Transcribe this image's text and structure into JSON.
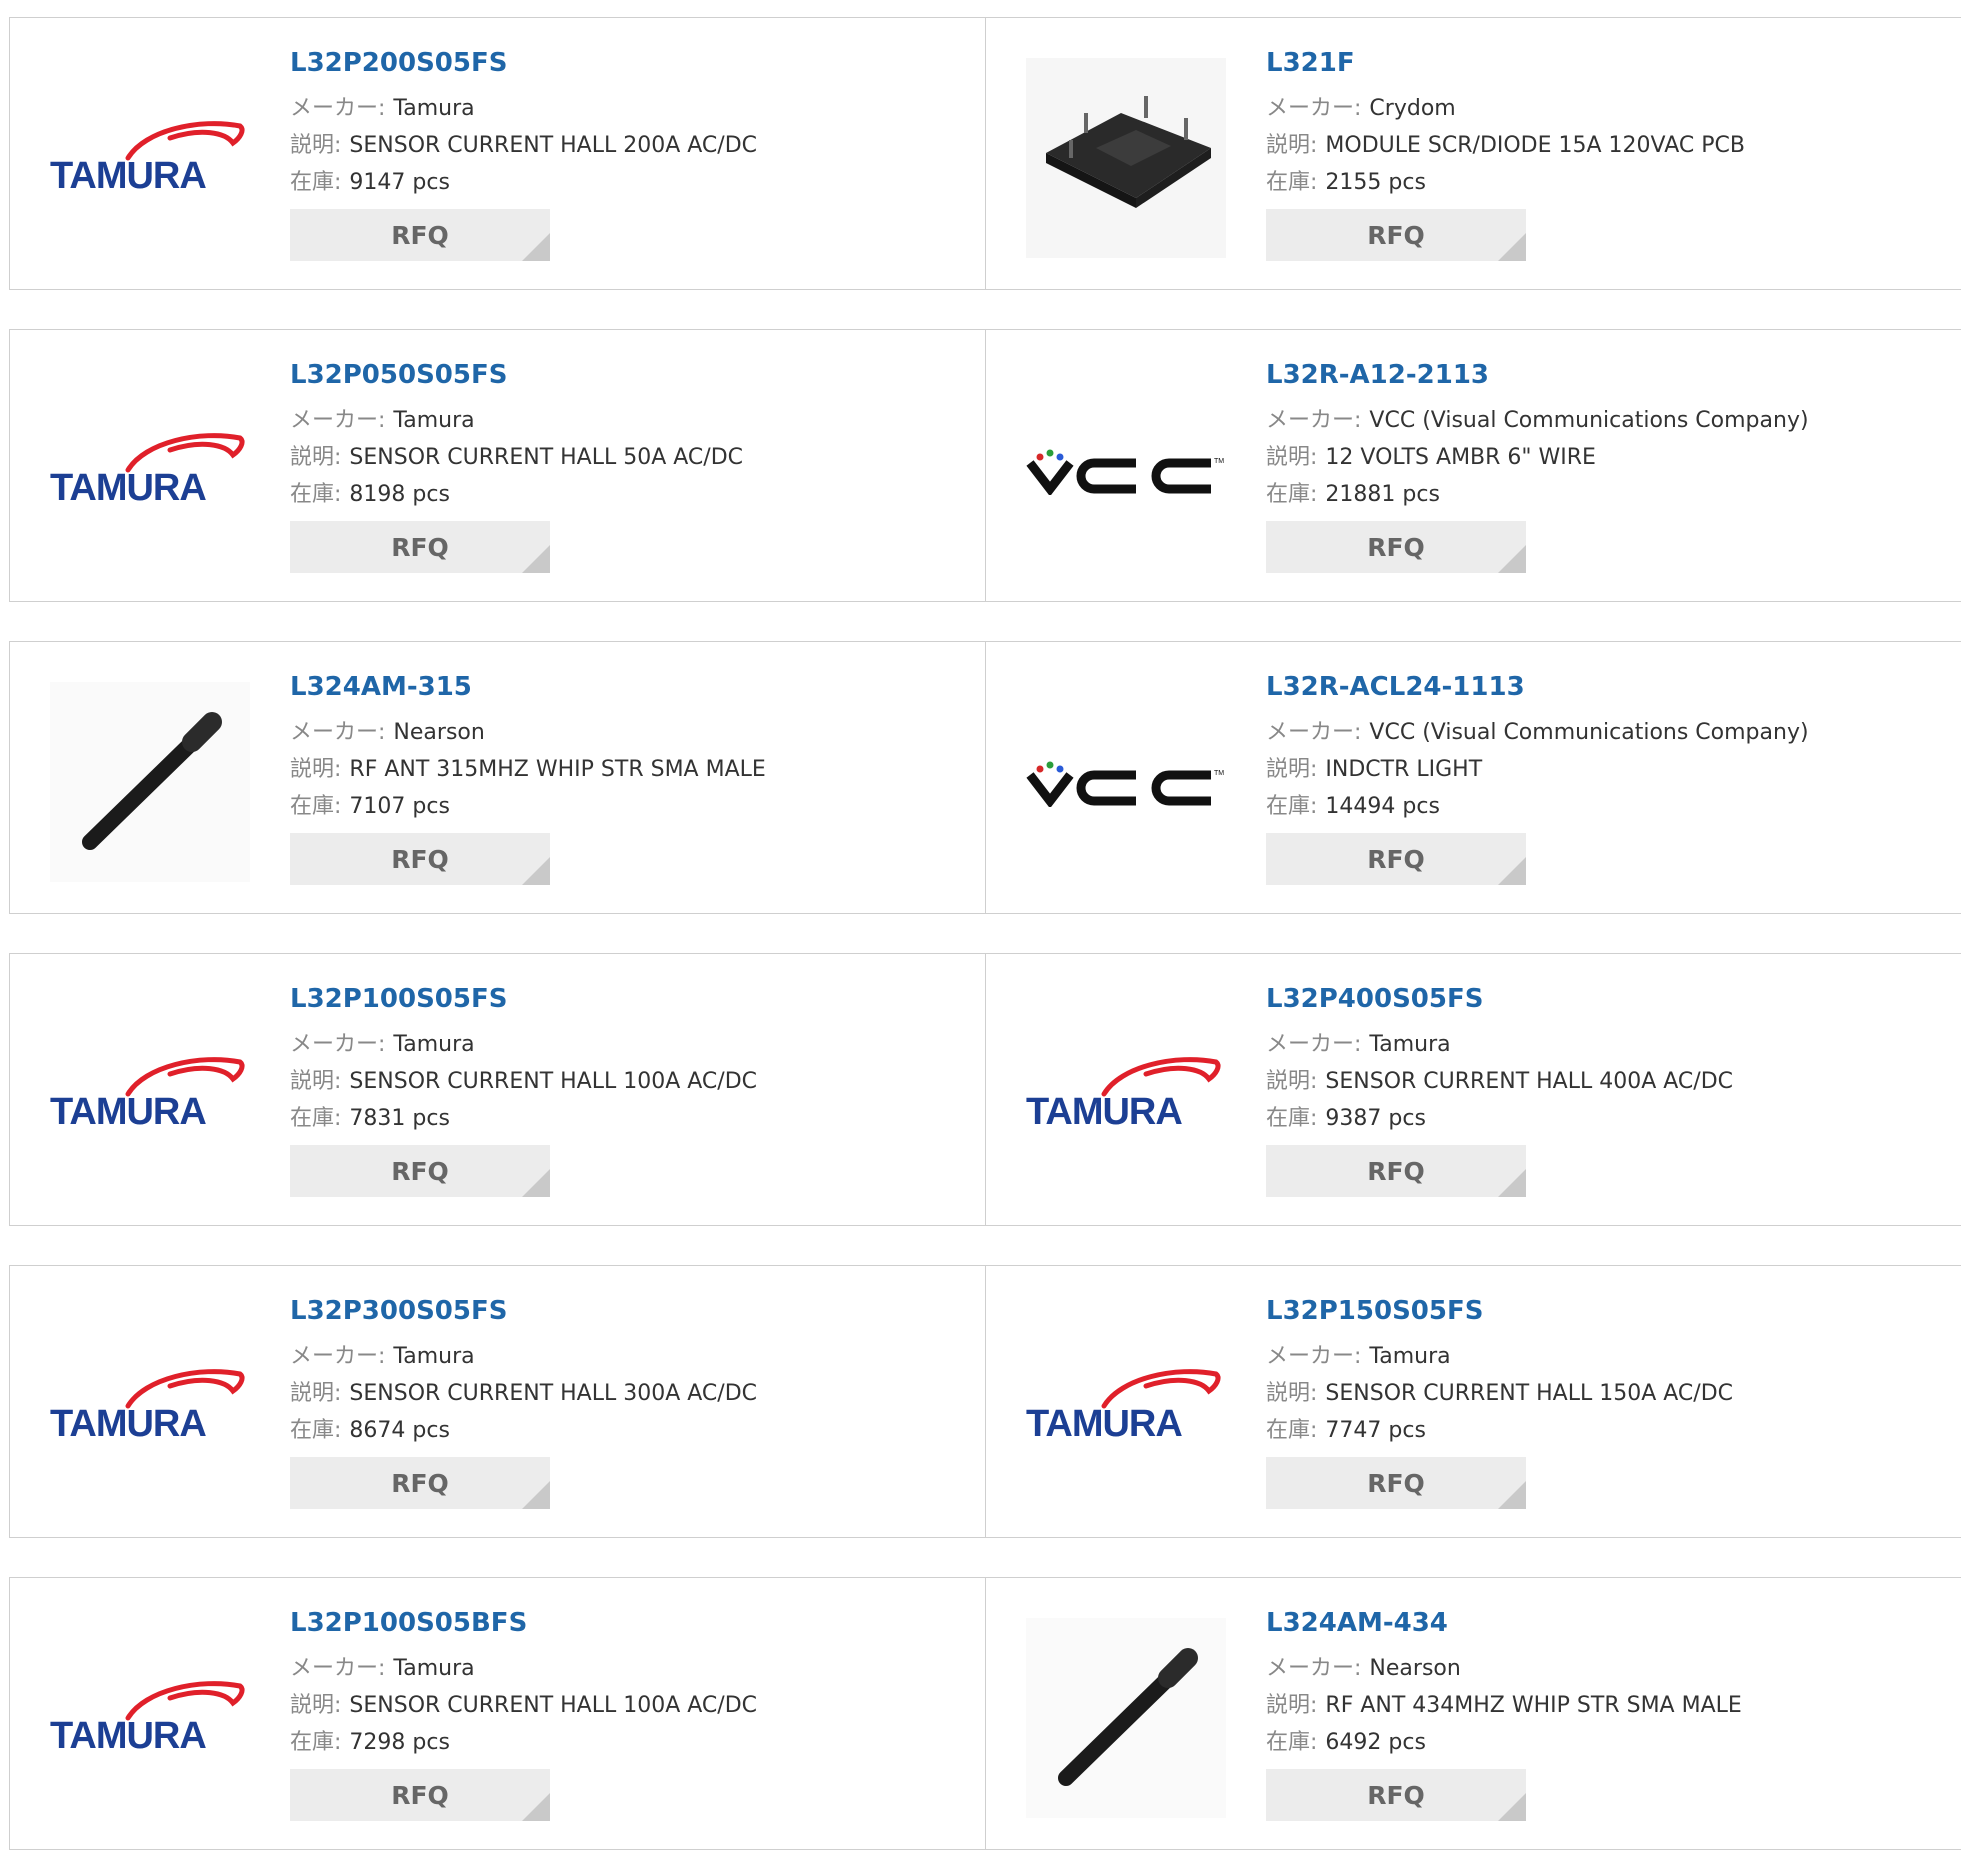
{
  "labels": {
    "maker": "メーカー:",
    "desc": "説明:",
    "stock": "在庫:",
    "rfq": "RFQ"
  },
  "colors": {
    "link": "#1f66a8",
    "tamura_red": "#e0202a",
    "tamura_blue": "#1c3f94"
  },
  "rows": [
    [
      {
        "pn": "L32P200S05FS",
        "maker": "Tamura",
        "desc": "SENSOR CURRENT HALL 200A AC/DC",
        "stock": "9147 pcs",
        "image": "tamura-logo"
      },
      {
        "pn": "L321F",
        "maker": "Crydom",
        "desc": "MODULE SCR/DIODE 15A 120VAC PCB",
        "stock": "2155 pcs",
        "image": "scr-module-photo"
      }
    ],
    [
      {
        "pn": "L32P050S05FS",
        "maker": "Tamura",
        "desc": "SENSOR CURRENT HALL 50A AC/DC",
        "stock": "8198 pcs",
        "image": "tamura-logo"
      },
      {
        "pn": "L32R-A12-2113",
        "maker": "VCC (Visual Communications Company)",
        "desc": "12 VOLTS AMBR 6\" WIRE",
        "stock": "21881 pcs",
        "image": "vcc-logo"
      }
    ],
    [
      {
        "pn": "L324AM-315",
        "maker": "Nearson",
        "desc": "RF ANT 315MHZ WHIP STR SMA MALE",
        "stock": "7107 pcs",
        "image": "antenna-photo"
      },
      {
        "pn": "L32R-ACL24-1113",
        "maker": "VCC (Visual Communications Company)",
        "desc": "INDCTR LIGHT",
        "stock": "14494 pcs",
        "image": "vcc-logo"
      }
    ],
    [
      {
        "pn": "L32P100S05FS",
        "maker": "Tamura",
        "desc": "SENSOR CURRENT HALL 100A AC/DC",
        "stock": "7831 pcs",
        "image": "tamura-logo"
      },
      {
        "pn": "L32P400S05FS",
        "maker": "Tamura",
        "desc": "SENSOR CURRENT HALL 400A AC/DC",
        "stock": "9387 pcs",
        "image": "tamura-logo"
      }
    ],
    [
      {
        "pn": "L32P300S05FS",
        "maker": "Tamura",
        "desc": "SENSOR CURRENT HALL 300A AC/DC",
        "stock": "8674 pcs",
        "image": "tamura-logo"
      },
      {
        "pn": "L32P150S05FS",
        "maker": "Tamura",
        "desc": "SENSOR CURRENT HALL 150A AC/DC",
        "stock": "7747 pcs",
        "image": "tamura-logo"
      }
    ],
    [
      {
        "pn": "L32P100S05BFS",
        "maker": "Tamura",
        "desc": "SENSOR CURRENT HALL 100A AC/DC",
        "stock": "7298 pcs",
        "image": "tamura-logo"
      },
      {
        "pn": "L324AM-434",
        "maker": "Nearson",
        "desc": "RF ANT 434MHZ WHIP STR SMA MALE",
        "stock": "6492 pcs",
        "image": "antenna-photo"
      }
    ]
  ]
}
